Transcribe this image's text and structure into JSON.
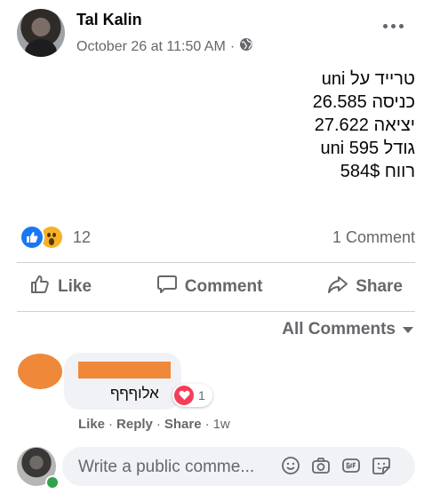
{
  "post": {
    "author": "Tal Kalin",
    "timestamp": "October 26 at 11:50 AM",
    "separator": "·",
    "body_lines": [
      "טרייד על uni",
      "כניסה 26.585",
      "יציאה 27.622",
      "גודל 595 uni",
      "רווח 584$"
    ]
  },
  "stats": {
    "reaction_count": "12",
    "comment_count": "1 Comment"
  },
  "actions": {
    "like": "Like",
    "comment": "Comment",
    "share": "Share"
  },
  "comments_filter": "All Comments",
  "comment": {
    "text": "אלוףףף",
    "reaction_count": "1",
    "like": "Like",
    "reply": "Reply",
    "share": "Share",
    "dot": "·",
    "age": "1w"
  },
  "composer": {
    "placeholder": "Write a public comme..."
  },
  "colors": {
    "accent": "#1877f2",
    "muted_text": "#65676b",
    "redaction": "#f0883a",
    "heart": "#f33e58",
    "online": "#31a24c"
  }
}
